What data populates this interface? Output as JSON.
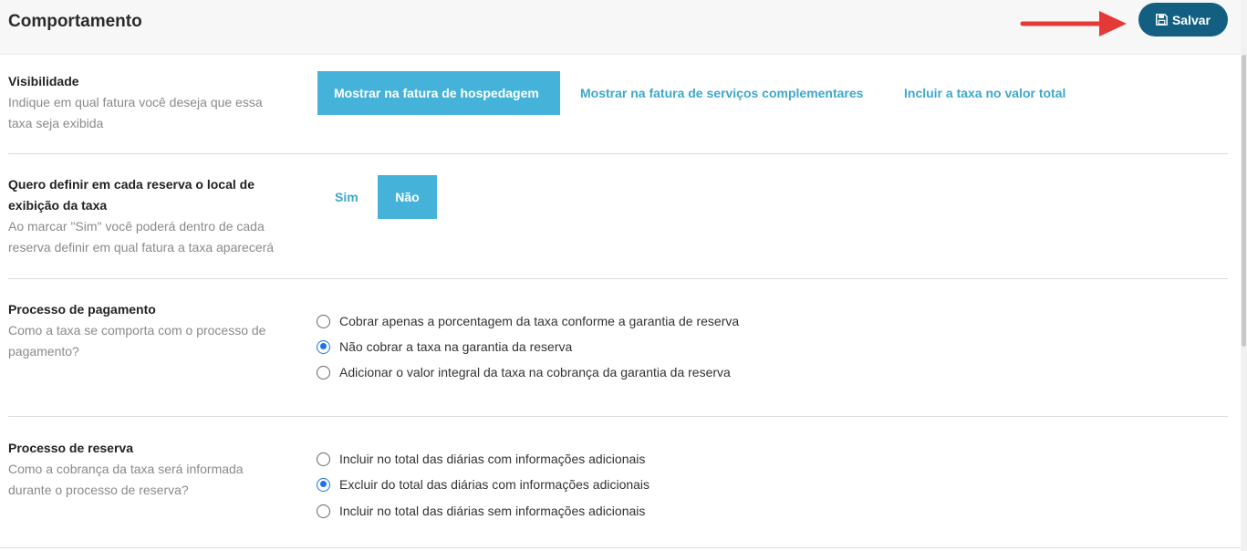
{
  "header": {
    "title": "Comportamento",
    "save_label": "Salvar"
  },
  "visibility": {
    "title": "Visibilidade",
    "desc_line1": "Indique em qual fatura você deseja que essa",
    "desc_line2": "taxa seja exibida",
    "options": [
      {
        "label": "Mostrar na fatura de hospedagem",
        "selected": true
      },
      {
        "label": "Mostrar na fatura de serviços complementares",
        "selected": false
      },
      {
        "label": "Incluir a taxa no valor total",
        "selected": false
      }
    ]
  },
  "define_local": {
    "title_line1": "Quero definir em cada reserva o local de",
    "title_line2": "exibição da taxa",
    "desc_line1": "Ao marcar \"Sim\" você poderá dentro de cada",
    "desc_line2": "reserva definir em qual fatura a taxa aparecerá",
    "options": [
      {
        "label": "Sim",
        "selected": false
      },
      {
        "label": "Não",
        "selected": true
      }
    ]
  },
  "payment_process": {
    "title": "Processo de pagamento",
    "desc_line1": "Como a taxa se comporta com o processo de",
    "desc_line2": "pagamento?",
    "options": [
      {
        "label": "Cobrar apenas a porcentagem da taxa conforme a garantia de reserva",
        "checked": false
      },
      {
        "label": "Não cobrar a taxa na garantia da reserva",
        "checked": true
      },
      {
        "label": "Adicionar o valor integral da taxa na cobrança da garantia da reserva",
        "checked": false
      }
    ]
  },
  "booking_process": {
    "title": "Processo de reserva",
    "desc_line1": "Como a cobrança da taxa será informada",
    "desc_line2": "durante o processo de reserva?",
    "options": [
      {
        "label": "Incluir no total das diárias com informações adicionais",
        "checked": false
      },
      {
        "label": "Excluir do total das diárias com informações adicionais",
        "checked": true
      },
      {
        "label": "Incluir no total das diárias sem informações adicionais",
        "checked": false
      }
    ]
  },
  "colors": {
    "primary_button": "#125f81",
    "segment_active": "#45b3d9",
    "segment_text": "#3da7cc",
    "radio_checked": "#1a73e8",
    "annotation_arrow": "#e53935"
  }
}
